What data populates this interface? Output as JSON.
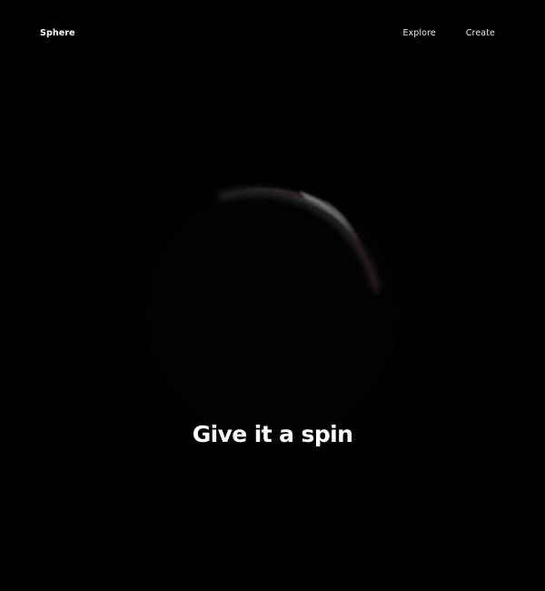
{
  "header": {
    "logo": "Sphere",
    "nav": [
      {
        "label": "Explore"
      },
      {
        "label": "Create"
      }
    ]
  },
  "hero": {
    "headline": "Give it a spin"
  },
  "theme": {
    "background": "#000000",
    "text": "#ffffff",
    "sphere_rim": "#b8b8b8",
    "sphere_rim_warm": "#5a1e1e"
  }
}
